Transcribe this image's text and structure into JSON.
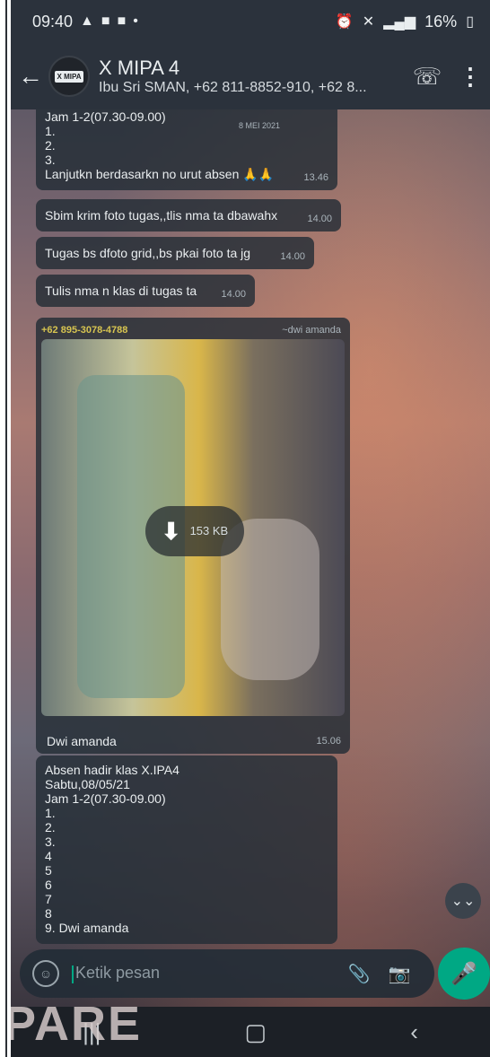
{
  "status_bar": {
    "time": "09:40",
    "battery": "16%"
  },
  "app_bar": {
    "title": "X MIPA 4",
    "subtitle": "Ibu Sri SMAN, +62 811-8852-910, +62 8...",
    "avatar_text": "X MIPA"
  },
  "messages": {
    "m1": {
      "top_line": "Jam 1-2(07.30-09.00)",
      "lines": [
        "1.",
        "2.",
        "3."
      ],
      "date": "8 MEI 2021",
      "text": "Lanjutkn berdasarkn no urut absen 🙏🙏",
      "time": "13.46"
    },
    "m2": {
      "text": "Sbim krim foto tugas,,tlis nma ta dbawahx",
      "time": "14.00"
    },
    "m3": {
      "text": "Tugas bs dfoto grid,,bs pkai foto ta jg",
      "time": "14.00"
    },
    "m4": {
      "text": "Tulis nma n klas di tugas ta",
      "time": "14.00"
    },
    "m5": {
      "sender": "+62 895-3078-4788",
      "alias": "~dwi amanda",
      "download_size": "153 KB",
      "caption": "Dwi amanda",
      "time": "15.06"
    },
    "m6": {
      "lines": [
        "Absen hadir klas X.IPA4",
        "Sabtu,08/05/21",
        "Jam 1-2(07.30-09.00)",
        "1.",
        "2.",
        "3.",
        "4",
        "5",
        "6",
        "7",
        "8",
        "9. Dwi amanda"
      ]
    }
  },
  "input": {
    "placeholder": "Ketik pesan"
  },
  "watermark": "PARE",
  "colors": {
    "bar": "#2b323c",
    "bubble": "#232d36",
    "accent": "#00a884"
  },
  "icons": {
    "back": "arrow-left",
    "call": "add-call",
    "menu": "three-dots-vertical",
    "download": "arrow-down",
    "scroll_down": "double-chevron-down",
    "emoji": "smiley",
    "attach": "paperclip",
    "camera": "camera",
    "mic": "microphone"
  }
}
